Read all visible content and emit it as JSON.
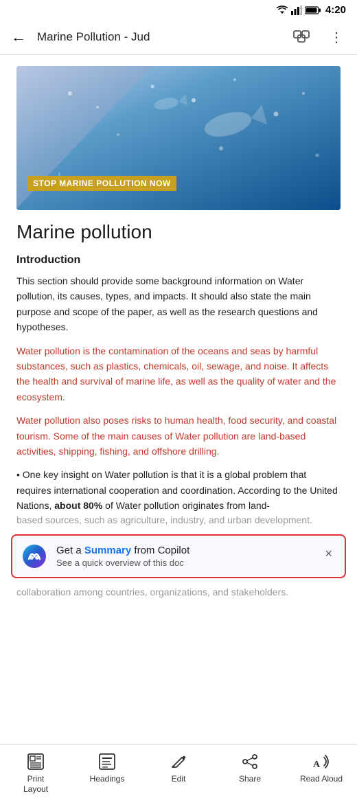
{
  "status_bar": {
    "time": "4:20"
  },
  "nav": {
    "title": "Marine Pollution - Jud",
    "back_label": "←",
    "more_label": "⋮"
  },
  "hero": {
    "badge_text": "STOP MARINE POLLUTION NOW"
  },
  "document": {
    "title": "Marine pollution",
    "section_heading": "Introduction",
    "intro_text": "This section should provide some background information on Water pollution, its causes, types, and impacts. It should also state the main purpose and scope of the paper, as well as the research questions and hypotheses.",
    "accent_paragraph_1": "Water pollution is the contamination of the oceans and seas by harmful substances, such as plastics, chemicals, oil, sewage, and noise. It affects the health and survival of marine life, as well as the quality of water and the ecosystem.",
    "accent_paragraph_2": "Water pollution also poses risks to human health, food security, and coastal tourism. Some of the main causes of Water pollution are land-based activities, shipping, fishing, and offshore drilling.",
    "mixed_paragraph": "• One key insight on Water pollution is that it is a global problem that requires international cooperation and coordination. According to the United Nations,",
    "mixed_bold": "about 80%",
    "mixed_after": "of Water pollution originates from land-",
    "faded_text_1": "based sources, such as agriculture, industry, and urban development.",
    "faded_text_2": "collaboration among countries, organizations, and stakeholders."
  },
  "copilot_banner": {
    "title_prefix": "Get a ",
    "summary_link": "Summary",
    "title_suffix": " from Copilot",
    "subtitle": "See a quick overview of this doc",
    "close_label": "×"
  },
  "toolbar": {
    "items": [
      {
        "id": "print-layout",
        "icon": "print-layout-icon",
        "label": "Print\nLayout"
      },
      {
        "id": "headings",
        "icon": "headings-icon",
        "label": "Headings"
      },
      {
        "id": "edit",
        "icon": "edit-icon",
        "label": "Edit"
      },
      {
        "id": "share",
        "icon": "share-icon",
        "label": "Share"
      },
      {
        "id": "read-aloud",
        "icon": "read-aloud-icon",
        "label": "Read Aloud"
      }
    ]
  }
}
